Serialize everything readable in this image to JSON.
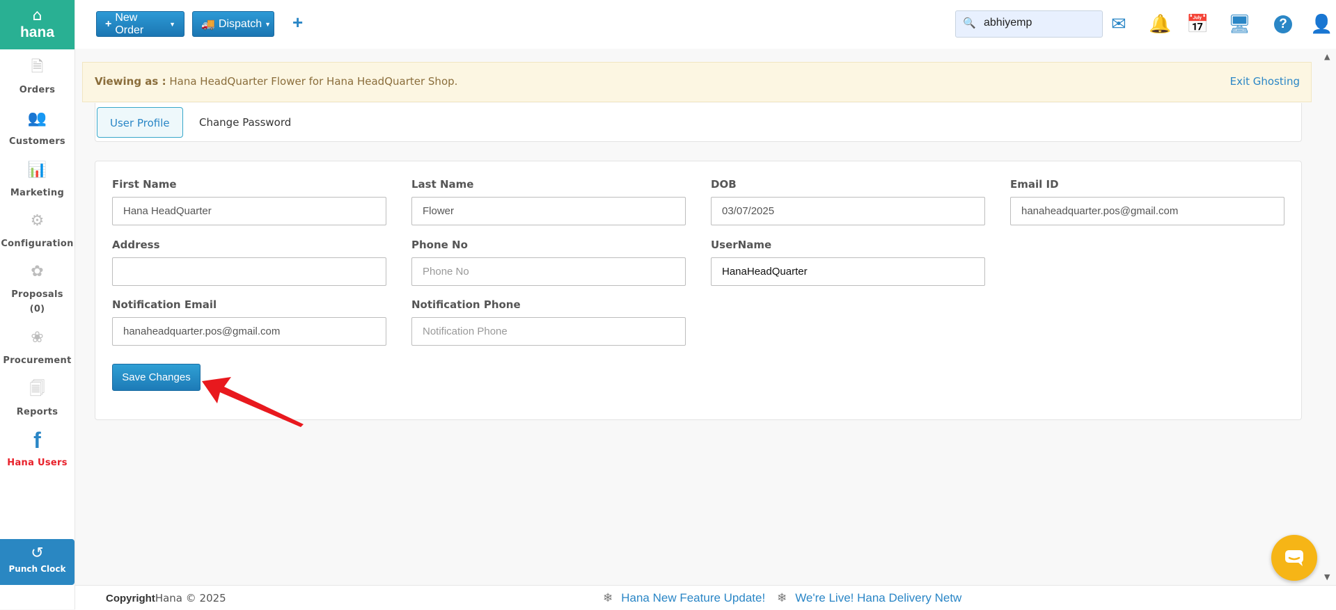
{
  "brand": {
    "name": "hana"
  },
  "sidebar": {
    "items": [
      {
        "label": "Orders"
      },
      {
        "label": "Customers"
      },
      {
        "label": "Marketing"
      },
      {
        "label": "Configuration"
      },
      {
        "label": "Proposals",
        "sub": "(0)"
      },
      {
        "label": "Procurement"
      },
      {
        "label": "Reports"
      },
      {
        "label": "Hana Users",
        "active": true
      }
    ],
    "punch_clock": "Punch Clock"
  },
  "topbar": {
    "new_order": "New Order",
    "dispatch": "Dispatch",
    "search_value": "abhiyemp"
  },
  "banner": {
    "prefix": "Viewing as :",
    "text": "Hana HeadQuarter Flower for Hana HeadQuarter Shop.",
    "exit": "Exit Ghosting"
  },
  "tabs": {
    "active": "User Profile",
    "other": "Change Password"
  },
  "form": {
    "first_name": {
      "label": "First Name",
      "value": "Hana HeadQuarter"
    },
    "last_name": {
      "label": "Last Name",
      "value": "Flower"
    },
    "dob": {
      "label": "DOB",
      "value": "03/07/2025"
    },
    "email": {
      "label": "Email ID",
      "value": "hanaheadquarter.pos@gmail.com"
    },
    "address": {
      "label": "Address",
      "value": ""
    },
    "phone": {
      "label": "Phone No",
      "value": "",
      "placeholder": "Phone No"
    },
    "username": {
      "label": "UserName",
      "value": "HanaHeadQuarter"
    },
    "notif_email": {
      "label": "Notification Email",
      "value": "hanaheadquarter.pos@gmail.com"
    },
    "notif_phone": {
      "label": "Notification Phone",
      "value": "",
      "placeholder": "Notification Phone"
    },
    "save": "Save Changes"
  },
  "footer": {
    "copyright_bold": "Copyright",
    "copyright_rest": "Hana © 2025",
    "ticker_1": "Hana New Feature Update!",
    "ticker_2": "We're Live! Hana Delivery Netw"
  },
  "colors": {
    "brand_green": "#29b093",
    "primary_blue": "#2a86c6",
    "active_red": "#e8202a",
    "banner_bg": "#fcf6e2"
  }
}
